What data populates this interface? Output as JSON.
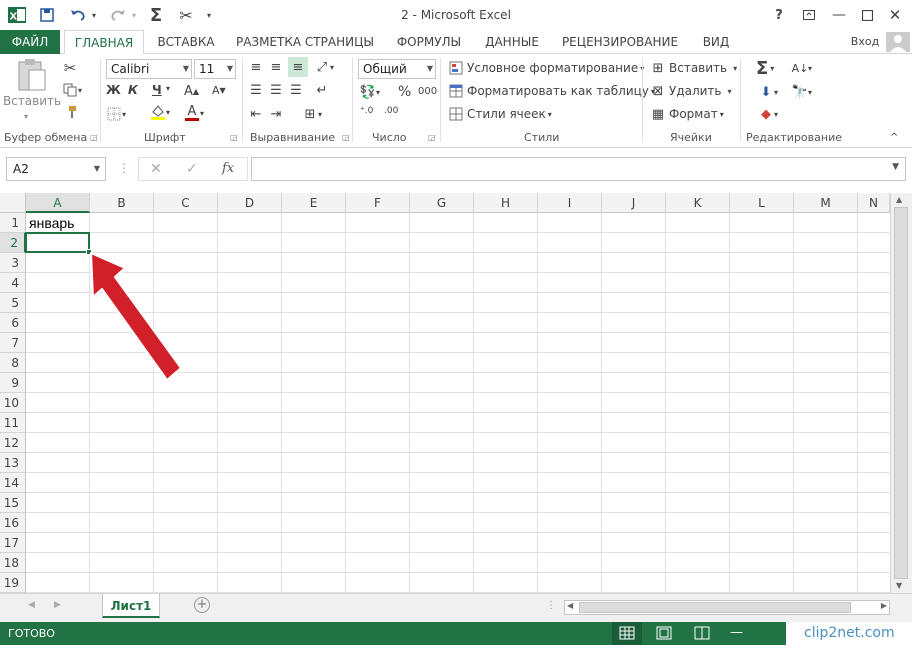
{
  "window": {
    "title": "2 - Microsoft Excel"
  },
  "quick_access": {
    "excel_icon": "excel-logo-icon",
    "save": "save-icon",
    "undo": "undo-icon",
    "redo": "redo-icon",
    "autosum": "autosum-icon",
    "cut": "cut-icon"
  },
  "window_controls": {
    "help": "?",
    "ribbon_display": "ribbon-display-icon",
    "minimize": "minimize-icon",
    "maximize": "maximize-icon",
    "close": "close-icon"
  },
  "tabs": {
    "file": "ФАЙЛ",
    "home": "ГЛАВНАЯ",
    "insert": "ВСТАВКА",
    "page_layout": "РАЗМЕТКА СТРАНИЦЫ",
    "formulas": "ФОРМУЛЫ",
    "data": "ДАННЫЕ",
    "review": "РЕЦЕНЗИРОВАНИЕ",
    "view": "ВИД",
    "signin": "Вход"
  },
  "ribbon": {
    "clipboard": {
      "label": "Буфер обмена",
      "paste": "Вставить"
    },
    "font": {
      "label": "Шрифт",
      "name": "Calibri",
      "size": "11",
      "bold": "Ж",
      "italic": "К",
      "underline": "Ч"
    },
    "alignment": {
      "label": "Выравнивание"
    },
    "number": {
      "label": "Число",
      "format": "Общий",
      "percent": "%",
      "thousands": "000"
    },
    "styles": {
      "label": "Стили",
      "conditional": "Условное форматирование",
      "format_table": "Форматировать как таблицу",
      "cell_styles": "Стили ячеек"
    },
    "cells": {
      "label": "Ячейки",
      "insert": "Вставить",
      "delete": "Удалить",
      "format": "Формат"
    },
    "editing": {
      "label": "Редактирование"
    }
  },
  "formula_bar": {
    "name_box": "A2",
    "fx": "fx",
    "value": ""
  },
  "grid": {
    "columns": [
      "A",
      "B",
      "C",
      "D",
      "E",
      "F",
      "G",
      "H",
      "I",
      "J",
      "K",
      "L",
      "M",
      "N"
    ],
    "rows": [
      "1",
      "2",
      "3",
      "4",
      "5",
      "6",
      "7",
      "8",
      "9",
      "10",
      "11",
      "12",
      "13",
      "14",
      "15",
      "16",
      "17",
      "18",
      "19"
    ],
    "selected_cell": "A2",
    "cells": {
      "A1": "январь"
    }
  },
  "sheets": {
    "active": "Лист1"
  },
  "status": {
    "ready": "ГОТОВО"
  },
  "watermark": {
    "text": "clip2net.com"
  },
  "colors": {
    "accent": "#217346",
    "arrow": "#d1202a"
  }
}
